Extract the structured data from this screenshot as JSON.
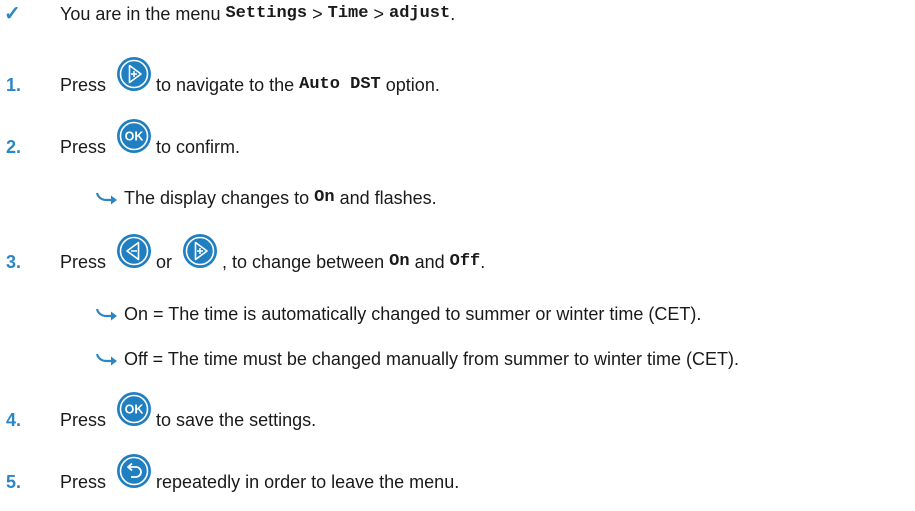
{
  "intro": {
    "prefix": "You are in the menu",
    "menu_1": "Settings",
    "sep_1": ">",
    "menu_2": "Time",
    "sep_2": ">",
    "menu_3": "adjust",
    "suffix": "."
  },
  "steps": [
    {
      "number": "1.",
      "press": "Press",
      "after": "to navigate to the",
      "option": "Auto DST",
      "end": "option."
    },
    {
      "number": "2.",
      "press": "Press",
      "after": "to confirm.",
      "result": {
        "before": "The display changes to",
        "value": "On",
        "after": "and flashes."
      }
    },
    {
      "number": "3.",
      "press": "Press",
      "or": "or",
      "after": ", to change between",
      "value_1": "On",
      "and": "and",
      "value_2": "Off",
      "end": ".",
      "results": [
        "On = The time is automatically changed to summer or winter time (CET).",
        "Off = The time must be changed manually from summer to winter time (CET)."
      ]
    },
    {
      "number": "4.",
      "press": "Press",
      "after": "to save the settings."
    },
    {
      "number": "5.",
      "press": "Press",
      "after": "repeatedly in order to leave the menu."
    }
  ],
  "buttons": {
    "ok_label": "OK"
  },
  "colors": {
    "accent": "#2c86c6",
    "button_fill": "#1f7fc1",
    "text": "#1a1a1a"
  },
  "icons": [
    "check-icon",
    "next-button-icon",
    "ok-button-icon",
    "previous-button-icon",
    "back-button-icon",
    "result-arrow-icon"
  ]
}
